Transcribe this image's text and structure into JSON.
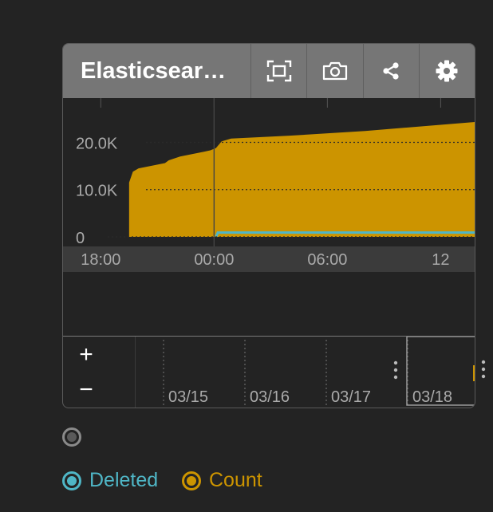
{
  "panel": {
    "title": "Elasticsear…",
    "toolbar": [
      {
        "name": "fullscreen-icon"
      },
      {
        "name": "camera-icon"
      },
      {
        "name": "share-icon"
      },
      {
        "name": "gear-icon"
      }
    ]
  },
  "colors": {
    "count": "#cc9400",
    "deleted": "#4fb6c6",
    "header": "#767676",
    "axis_band": "#3b3b3b"
  },
  "chart_data": {
    "type": "area",
    "grid": true,
    "y_ticks": [
      "20.0K",
      "10.0K",
      "0"
    ],
    "y_tick_values": [
      20000,
      10000,
      0
    ],
    "x_ticks": [
      "18:00",
      "00:00",
      "06:00",
      "12"
    ],
    "x_tick_hours": [
      0,
      6,
      12,
      18
    ],
    "ylim": [
      0,
      27000
    ],
    "x_range_hours": [
      -2,
      19.8
    ],
    "cursor_hour": 6,
    "series": [
      {
        "name": "Count",
        "color": "#cc9400",
        "points": [
          [
            1.5,
            0
          ],
          [
            1.5,
            11500
          ],
          [
            1.7,
            13800
          ],
          [
            2.0,
            14500
          ],
          [
            3.4,
            15600
          ],
          [
            3.6,
            16200
          ],
          [
            4.2,
            17000
          ],
          [
            5.2,
            17800
          ],
          [
            5.8,
            18300
          ],
          [
            6.1,
            18800
          ],
          [
            6.4,
            20200
          ],
          [
            6.9,
            20800
          ],
          [
            10,
            21400
          ],
          [
            14,
            22400
          ],
          [
            19.8,
            24300
          ]
        ]
      },
      {
        "name": "Deleted",
        "color": "#4fb6c6",
        "points": [
          [
            6.1,
            0
          ],
          [
            6.2,
            900
          ],
          [
            19.8,
            900
          ]
        ]
      }
    ]
  },
  "navigator": {
    "zoom_in": "+",
    "zoom_out": "−",
    "dates": [
      "03/15",
      "03/16",
      "03/17",
      "03/18"
    ]
  },
  "legend": [
    {
      "label": "",
      "state": "neutral"
    },
    {
      "label": "Deleted",
      "color": "#4fb6c6"
    },
    {
      "label": "Count",
      "color": "#cc9400"
    }
  ]
}
